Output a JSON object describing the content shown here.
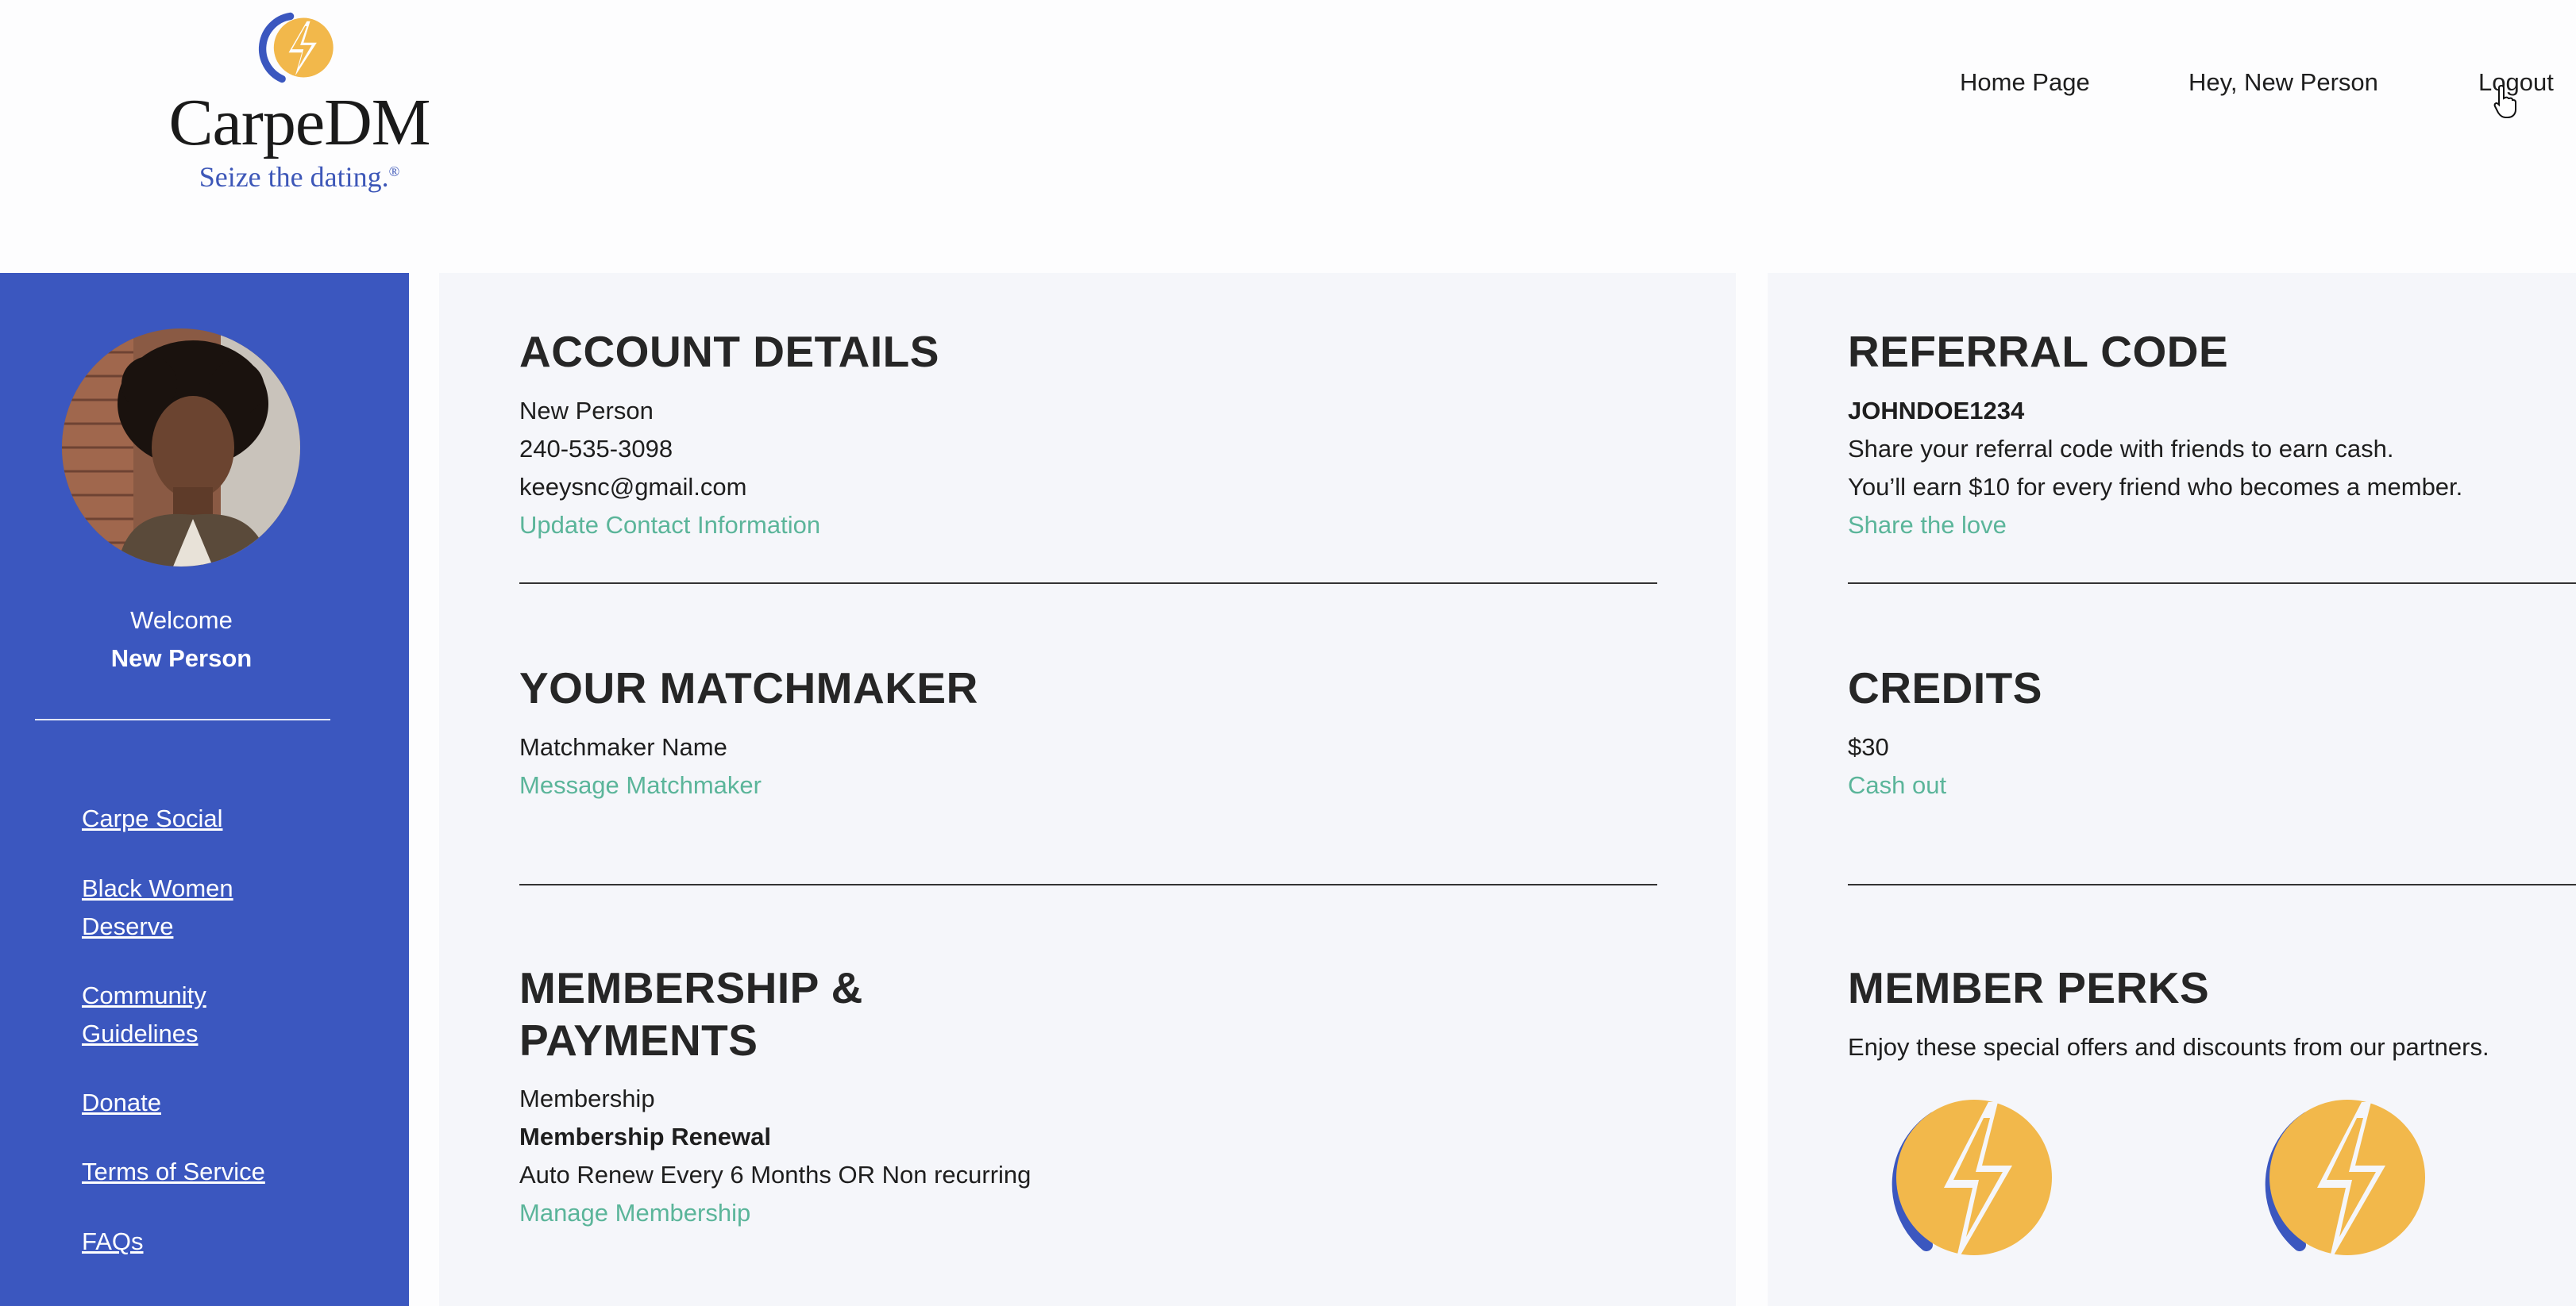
{
  "header": {
    "logo_word": "CarpeDM",
    "logo_tagline": "Seize the dating.",
    "logo_reg": "®",
    "nav": {
      "home": "Home Page",
      "greeting": "Hey, New Person",
      "logout": "Logout"
    }
  },
  "sidebar": {
    "welcome": "Welcome",
    "name": "New Person",
    "links": [
      {
        "label": "Carpe Social"
      },
      {
        "label": "Black Women Deserve"
      },
      {
        "label": "Community Guidelines"
      },
      {
        "label": "Donate"
      },
      {
        "label": "Terms of Service"
      },
      {
        "label": "FAQs"
      }
    ]
  },
  "account": {
    "title": "ACCOUNT DETAILS",
    "name": "New Person",
    "phone": "240-535-3098",
    "email": "keeysnc@gmail.com",
    "update_link": "Update Contact Information"
  },
  "matchmaker": {
    "title": "YOUR MATCHMAKER",
    "name": "Matchmaker Name",
    "message_link": "Message Matchmaker"
  },
  "membership": {
    "title_line1": "MEMBERSHIP &",
    "title_line2": "PAYMENTS",
    "membership_label": "Membership",
    "renewal_label": "Membership Renewal",
    "renewal_value": "Auto Renew Every 6 Months OR Non recurring",
    "manage_link": "Manage Membership"
  },
  "referral": {
    "title": "REFERRAL CODE",
    "code": "JOHNDOE1234",
    "line1": "Share your referral code with friends to earn cash.",
    "line2": "You’ll earn $10 for every friend who becomes a member.",
    "share_link": "Share the love"
  },
  "credits": {
    "title": "CREDITS",
    "amount": "$30",
    "cashout_link": "Cash out"
  },
  "perks": {
    "title": "MEMBER PERKS",
    "description": "Enjoy these special offers and discounts from our partners."
  },
  "colors": {
    "brand_blue": "#3b57bf",
    "link_green": "#5bb59a",
    "bolt_yellow": "#f2b84b"
  }
}
